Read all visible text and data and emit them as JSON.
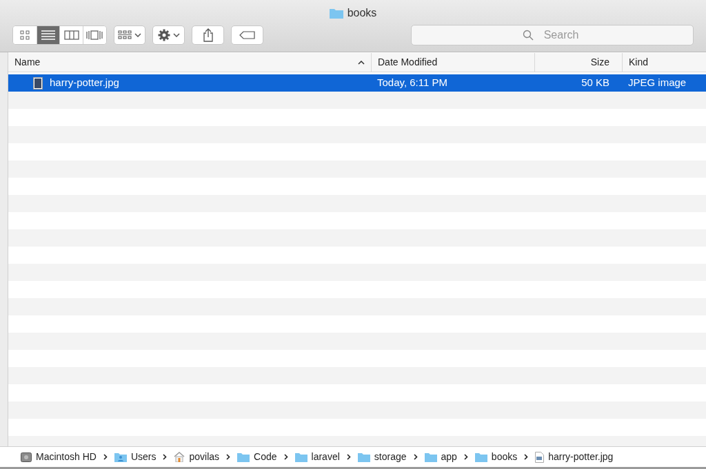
{
  "window": {
    "title": "books"
  },
  "toolbar": {
    "view_modes": [
      {
        "kind": "icons",
        "selected": false
      },
      {
        "kind": "list",
        "selected": true
      },
      {
        "kind": "columns",
        "selected": false
      },
      {
        "kind": "coverflow",
        "selected": false
      }
    ]
  },
  "search": {
    "placeholder": "Search"
  },
  "table": {
    "columns": [
      {
        "label": "Name",
        "sorted": true
      },
      {
        "label": "Date Modified",
        "sorted": false
      },
      {
        "label": "Size",
        "sorted": false
      },
      {
        "label": "Kind",
        "sorted": false
      }
    ],
    "rows": [
      {
        "name": "harry-potter.jpg",
        "date_modified": "Today, 6:11 PM",
        "size": "50 KB",
        "kind": "JPEG image",
        "selected": true
      }
    ]
  },
  "path_bar": [
    {
      "kind": "disk",
      "label": "Macintosh HD"
    },
    {
      "kind": "user-folder",
      "label": "Users"
    },
    {
      "kind": "home",
      "label": "povilas"
    },
    {
      "kind": "folder",
      "label": "Code"
    },
    {
      "kind": "folder",
      "label": "laravel"
    },
    {
      "kind": "folder",
      "label": "storage"
    },
    {
      "kind": "folder",
      "label": "app"
    },
    {
      "kind": "folder",
      "label": "books"
    },
    {
      "kind": "file",
      "label": "harry-potter.jpg"
    }
  ]
}
